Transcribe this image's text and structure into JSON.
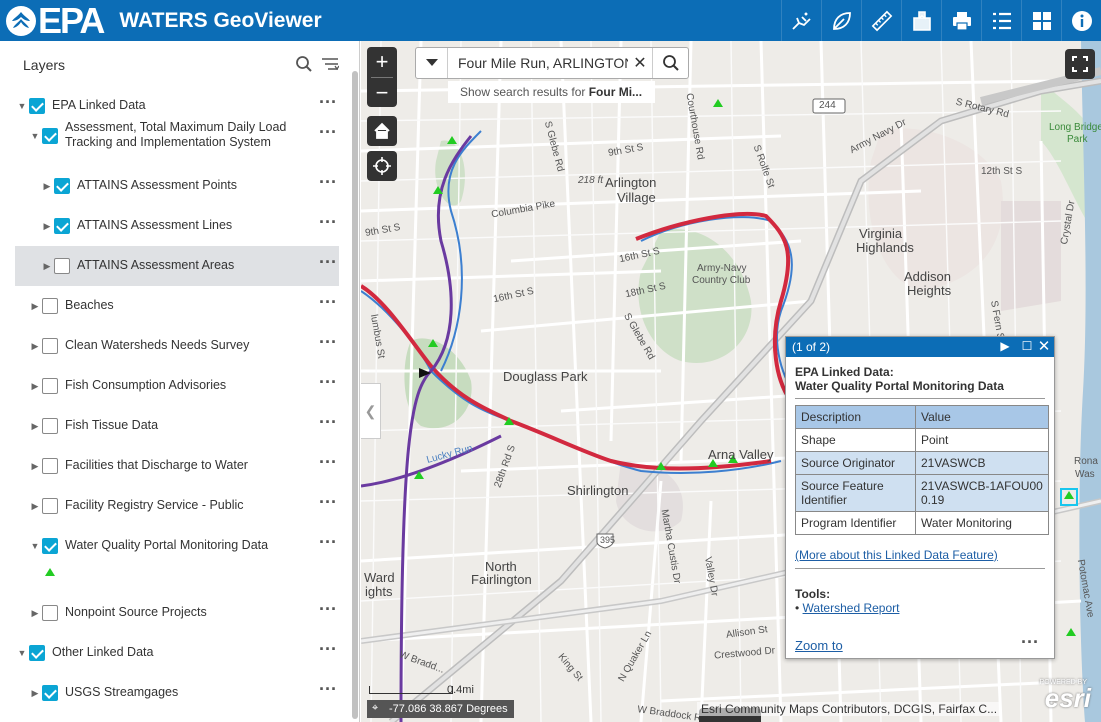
{
  "header": {
    "logo_text": "EPA",
    "app_title": "WATERS GeoViewer",
    "tools": [
      {
        "icon": "measure-walk-icon"
      },
      {
        "icon": "leaf-draw-icon"
      },
      {
        "icon": "ruler-icon"
      },
      {
        "icon": "bookmark-icon"
      },
      {
        "icon": "print-icon"
      },
      {
        "icon": "list-icon"
      },
      {
        "icon": "grid-icon"
      },
      {
        "icon": "info-icon"
      }
    ],
    "accent": "#0c6db6"
  },
  "sidebar": {
    "title": "Layers",
    "layers": [
      {
        "label": "EPA Linked Data",
        "checked": true,
        "expanded": true,
        "level": 0
      },
      {
        "label": "Assessment, Total Maximum Daily Load Tracking and Implementation System",
        "checked": true,
        "expanded": true,
        "level": 1
      },
      {
        "label": "ATTAINS Assessment Points",
        "checked": true,
        "expanded": false,
        "level": 2
      },
      {
        "label": "ATTAINS Assessment Lines",
        "checked": true,
        "expanded": false,
        "level": 2
      },
      {
        "label": "ATTAINS Assessment Areas",
        "checked": false,
        "expanded": false,
        "level": 2,
        "selected": true
      },
      {
        "label": "Beaches",
        "checked": false,
        "expanded": false,
        "level": 1
      },
      {
        "label": "Clean Watersheds Needs Survey",
        "checked": false,
        "expanded": false,
        "level": 1
      },
      {
        "label": "Fish Consumption Advisories",
        "checked": false,
        "expanded": false,
        "level": 1
      },
      {
        "label": "Fish Tissue Data",
        "checked": false,
        "expanded": false,
        "level": 1
      },
      {
        "label": "Facilities that Discharge to Water",
        "checked": false,
        "expanded": false,
        "level": 1
      },
      {
        "label": "Facility Registry Service - Public",
        "checked": false,
        "expanded": false,
        "level": 1
      },
      {
        "label": "Water Quality Portal Monitoring Data",
        "checked": true,
        "expanded": true,
        "level": 1
      },
      {
        "label": "Nonpoint Source Projects",
        "checked": false,
        "expanded": false,
        "level": 1
      },
      {
        "label": "Other Linked Data",
        "checked": true,
        "expanded": true,
        "level": 0
      },
      {
        "label": "USGS Streamgages",
        "checked": true,
        "expanded": false,
        "level": 1
      }
    ],
    "check_color": "#0ba5d4"
  },
  "search": {
    "value": "Four Mile Run, ARLINGTON",
    "hint_prefix": "Show search results for ",
    "hint_bold": "Four Mi..."
  },
  "map": {
    "labels": {
      "arlington": "Arlington",
      "village": "Village",
      "virginia": "Virginia",
      "highlands": "Highlands",
      "addison": "Addison",
      "heights": "Heights",
      "douglass": "Douglass Park",
      "armynavy1": "Army-Navy",
      "armynavy2": "Country Club",
      "arna": "Arna Valley",
      "shirlington": "Shirlington",
      "north": "North",
      "fairlington": "Fairlington",
      "ward": "Ward",
      "ights": "ights",
      "longbridge1": "Long Bridge",
      "longbridge2": "Park",
      "elev": "218 ft",
      "road244": "244",
      "road395": "395",
      "srotary": "S Rotary Rd",
      "armynavydr": "Army Navy Dr",
      "twelfth": "12th St S",
      "ninth": "9th St S",
      "ninth2": "9th St S",
      "sixteenth": "16th St S",
      "sixteenth2": "16th St S",
      "eighteenth": "18th St S",
      "columbia": "Columbia Pike",
      "sglebe": "S Glebe Rd",
      "sglebe2": "S Glebe Rd",
      "courthouse": "Courthouse Rd",
      "srolfe": "S Rolfe St",
      "twentyeighth": "28th Rd S",
      "luckyrun": "Lucky Run",
      "marthacustis": "Martha Custis Dr",
      "valleydr": "Valley Dr",
      "allison": "Allison St",
      "crestwood": "Crestwood Dr",
      "braddock": "W Braddock Rd",
      "wbrad": "W Bradd...",
      "kingst": "King St",
      "quaker": "N Quaker Ln",
      "potomac": "Potomac Ave",
      "crystal": "Crystal Dr",
      "sfern": "S Fern St",
      "lumbus": "lumbus St",
      "ronal": "Rona",
      "was": "Was"
    },
    "coords": "-77.086 38.867 Degrees",
    "scale_label": "0.4mi",
    "attribution": "Esri Community Maps Contributors, DCGIS, Fairfax C...",
    "brand": "esri",
    "powered_by": "POWERED BY"
  },
  "popup": {
    "counter": "(1 of 2)",
    "title_line1": "EPA Linked Data:",
    "title_line2": "Water Quality Portal Monitoring Data",
    "headers": [
      "Description",
      "Value"
    ],
    "rows": [
      {
        "desc": "Shape",
        "value": "Point"
      },
      {
        "desc": "Source Originator",
        "value": "21VASWCB"
      },
      {
        "desc": "Source Feature Identifier",
        "value": "21VASWCB-1AFOU000.19"
      },
      {
        "desc": "Program Identifier",
        "value": "Water Monitoring"
      }
    ],
    "more_link": "(More about this Linked Data Feature)",
    "tools_label": "Tools:",
    "tool_link": "Watershed Report",
    "zoom": "Zoom to"
  }
}
